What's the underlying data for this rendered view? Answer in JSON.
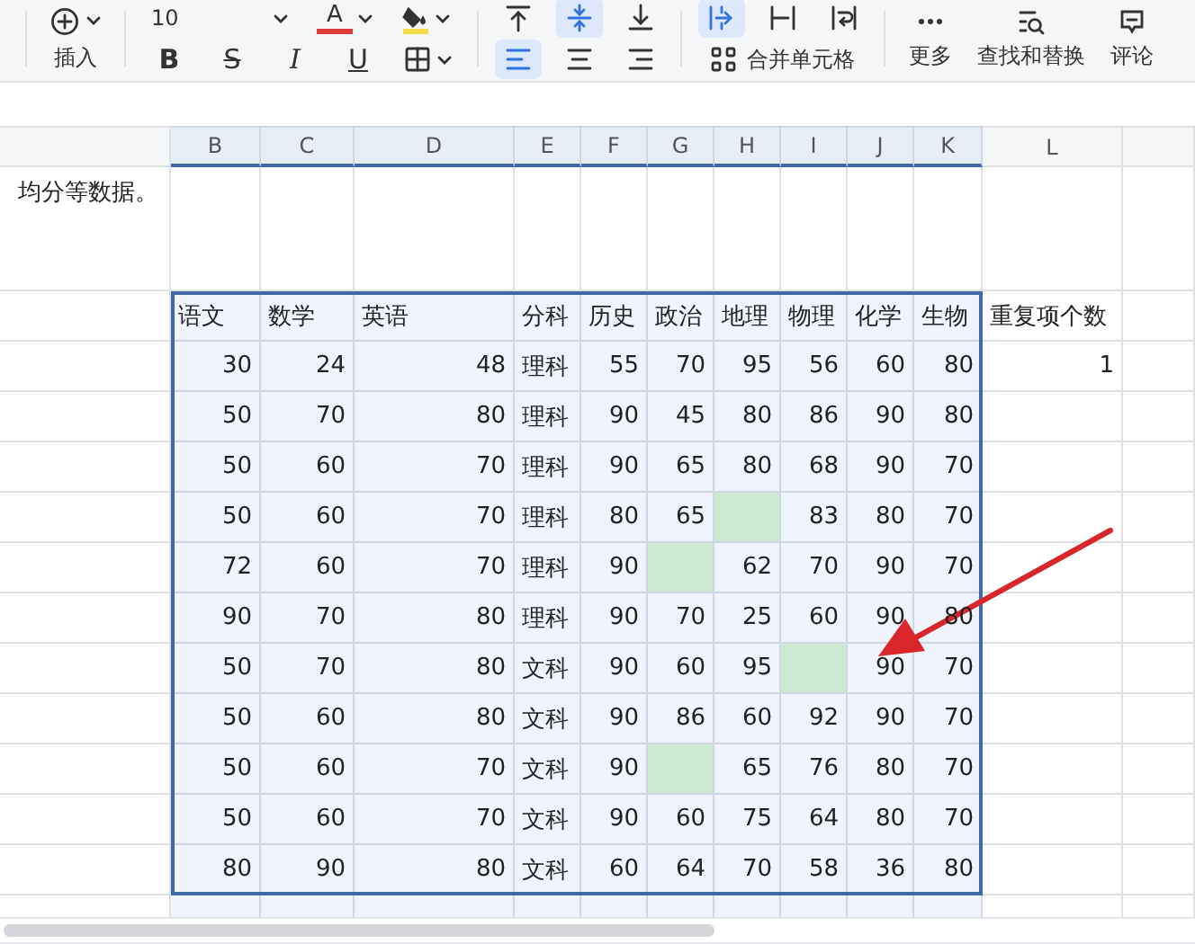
{
  "toolbar": {
    "insert": {
      "label": "插入"
    },
    "font_size": "10",
    "font_color": {
      "glyph": "A",
      "color": "#e03b3b"
    },
    "fill_color": {
      "color": "#f2de4b"
    },
    "format_buttons": [
      {
        "kind": "bold",
        "glyph": "B"
      },
      {
        "kind": "strike",
        "glyph": "S"
      },
      {
        "kind": "italic",
        "glyph": "I"
      },
      {
        "kind": "underline",
        "glyph": "U"
      },
      {
        "kind": "border"
      }
    ],
    "align_buttons": [
      {
        "kind": "top",
        "selected": false
      },
      {
        "kind": "middle",
        "selected": true
      },
      {
        "kind": "bottom",
        "selected": false
      },
      {
        "kind": "left",
        "selected": true
      },
      {
        "kind": "center",
        "selected": false
      },
      {
        "kind": "right",
        "selected": false
      }
    ],
    "wrap_buttons": [
      {
        "kind": "overflow",
        "selected": true
      },
      {
        "kind": "clip",
        "selected": false
      },
      {
        "kind": "wrap",
        "selected": false
      }
    ],
    "merge": {
      "label": "合并单元格"
    },
    "actions": [
      {
        "kind": "more",
        "label": "更多"
      },
      {
        "kind": "find",
        "label": "查找和替换"
      },
      {
        "kind": "comment",
        "label": "评论"
      }
    ]
  },
  "sheet": {
    "columns": [
      "B",
      "C",
      "D",
      "E",
      "F",
      "G",
      "H",
      "I",
      "J",
      "K",
      "L"
    ],
    "note": "均分等数据。",
    "headers": [
      "语文",
      "数学",
      "英语",
      "分科",
      "历史",
      "政治",
      "地理",
      "物理",
      "化学",
      "生物"
    ],
    "extra_header": "重复项个数",
    "rows": [
      {
        "cells": [
          "30",
          "24",
          "48",
          "理科",
          "55",
          "70",
          "95",
          "56",
          "60",
          "80"
        ],
        "extra": "1"
      },
      {
        "cells": [
          "50",
          "70",
          "80",
          "理科",
          "90",
          "45",
          "80",
          "86",
          "90",
          "80"
        ]
      },
      {
        "cells": [
          "50",
          "60",
          "70",
          "理科",
          "90",
          "65",
          "80",
          "68",
          "90",
          "70"
        ]
      },
      {
        "cells": [
          "50",
          "60",
          "70",
          "理科",
          "80",
          "65",
          {
            "highlighted": true
          },
          "83",
          "80",
          "70"
        ]
      },
      {
        "cells": [
          "72",
          "60",
          "70",
          "理科",
          "90",
          {
            "highlighted": true
          },
          "62",
          "70",
          "90",
          "70"
        ]
      },
      {
        "cells": [
          "90",
          "70",
          "80",
          "理科",
          "90",
          "70",
          "25",
          "60",
          "90",
          "80"
        ]
      },
      {
        "cells": [
          "50",
          "70",
          "80",
          "文科",
          "90",
          "60",
          "95",
          {
            "highlighted": true
          },
          "90",
          "70"
        ]
      },
      {
        "cells": [
          "50",
          "60",
          "80",
          "文科",
          "90",
          "86",
          "60",
          "92",
          "90",
          "70"
        ]
      },
      {
        "cells": [
          "50",
          "60",
          "70",
          "文科",
          "90",
          {
            "highlighted": true
          },
          "65",
          "76",
          "80",
          "70"
        ]
      },
      {
        "cells": [
          "50",
          "60",
          "70",
          "文科",
          "90",
          "60",
          "75",
          "64",
          "80",
          "70"
        ]
      },
      {
        "cells": [
          "80",
          "90",
          "80",
          "文科",
          "60",
          "64",
          "70",
          "58",
          "36",
          "80"
        ]
      }
    ]
  },
  "annotation": {
    "kind": "arrow",
    "color": "#d8262a"
  }
}
